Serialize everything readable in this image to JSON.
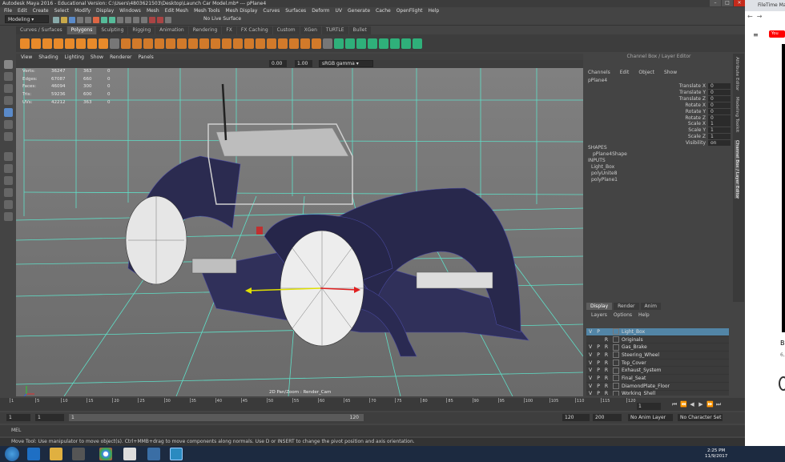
{
  "window": {
    "title": "Autodesk Maya 2016 - Educational Version: C:\\Users\\4803621503\\Desktop\\Launch Car Model.mb* --- pPlane4"
  },
  "menubar": [
    "File",
    "Edit",
    "Create",
    "Select",
    "Modify",
    "Display",
    "Windows",
    "Mesh",
    "Edit Mesh",
    "Mesh Tools",
    "Mesh Display",
    "Curves",
    "Surfaces",
    "Deform",
    "UV",
    "Generate",
    "Cache",
    "OpenFlight",
    "Help"
  ],
  "statusline": {
    "mode": "Modeling",
    "live_surface": "No Live Surface"
  },
  "shelf": {
    "tabs": [
      "Curves / Surfaces",
      "Polygons",
      "Sculpting",
      "Rigging",
      "Animation",
      "Rendering",
      "FX",
      "FX Caching",
      "Custom",
      "XGen",
      "TURTLE",
      "Bullet"
    ],
    "active": "Polygons"
  },
  "viewport": {
    "menus": [
      "View",
      "Shading",
      "Lighting",
      "Show",
      "Renderer",
      "Panels"
    ],
    "near": "0.00",
    "far": "1.00",
    "colorspace": "sRGB gamma",
    "hud": [
      {
        "label": "Verts:",
        "v1": "36247",
        "v2": "363",
        "v3": "0"
      },
      {
        "label": "Edges:",
        "v1": "67087",
        "v2": "660",
        "v3": "0"
      },
      {
        "label": "Faces:",
        "v1": "46094",
        "v2": "300",
        "v3": "0"
      },
      {
        "label": "Tris:",
        "v1": "59236",
        "v2": "600",
        "v3": "0"
      },
      {
        "label": "UVs:",
        "v1": "42212",
        "v2": "363",
        "v3": "0"
      }
    ],
    "camera_label": "2D Pan/Zoom : Render_Cam"
  },
  "channel_box": {
    "header": "Channel Box / Layer Editor",
    "menus": [
      "Channels",
      "Edit",
      "Object",
      "Show"
    ],
    "node": "pPlane4",
    "attributes": [
      {
        "name": "Translate X",
        "value": "0"
      },
      {
        "name": "Translate Y",
        "value": "0"
      },
      {
        "name": "Translate Z",
        "value": "0"
      },
      {
        "name": "Rotate X",
        "value": "0"
      },
      {
        "name": "Rotate Y",
        "value": "0"
      },
      {
        "name": "Rotate Z",
        "value": "0"
      },
      {
        "name": "Scale X",
        "value": "1"
      },
      {
        "name": "Scale Y",
        "value": "1"
      },
      {
        "name": "Scale Z",
        "value": "1"
      },
      {
        "name": "Visibility",
        "value": "on"
      }
    ],
    "shapes_header": "SHAPES",
    "shape": "pPlane4Shape",
    "inputs_header": "INPUTS",
    "inputs": [
      "Light_Box",
      "polyUnite8",
      "polyPlane1"
    ]
  },
  "side_tabs": [
    "Attribute Editor",
    "Modeling Toolkit",
    "Channel Box / Layer Editor"
  ],
  "layers": {
    "tabs": [
      "Display",
      "Render",
      "Anim"
    ],
    "active": "Display",
    "menus": [
      "Layers",
      "Options",
      "Help"
    ],
    "rows": [
      {
        "v": "V",
        "p": "P",
        "r": "",
        "name": "Light_Box",
        "selected": true
      },
      {
        "v": "",
        "p": "",
        "r": "R",
        "name": "Originals",
        "selected": false
      },
      {
        "v": "V",
        "p": "P",
        "r": "R",
        "name": "Gas_Brake",
        "selected": false
      },
      {
        "v": "V",
        "p": "P",
        "r": "R",
        "name": "Steering_Wheel",
        "selected": false
      },
      {
        "v": "V",
        "p": "P",
        "r": "R",
        "name": "Top_Cover",
        "selected": false
      },
      {
        "v": "V",
        "p": "P",
        "r": "R",
        "name": "Exhaust_System",
        "selected": false
      },
      {
        "v": "V",
        "p": "P",
        "r": "R",
        "name": "Final_Seat",
        "selected": false
      },
      {
        "v": "V",
        "p": "P",
        "r": "R",
        "name": "DiamondPlate_Floor",
        "selected": false
      },
      {
        "v": "V",
        "p": "P",
        "r": "R",
        "name": "Working_Shell",
        "selected": false
      }
    ]
  },
  "timeline": {
    "ticks": [
      "1",
      "5",
      "10",
      "15",
      "20",
      "25",
      "30",
      "35",
      "40",
      "45",
      "50",
      "55",
      "60",
      "65",
      "70",
      "75",
      "80",
      "85",
      "90",
      "95",
      "100",
      "105",
      "110",
      "115",
      "120"
    ],
    "current": "1"
  },
  "range": {
    "start": "1",
    "start2": "1",
    "slider_start": "1",
    "slider_end": "120",
    "end": "120",
    "end2": "200",
    "anim_layer": "No Anim Layer",
    "character_set": "No Character Set"
  },
  "cmdline": {
    "label": "MEL"
  },
  "helpline": "Move Tool: Use manipulator to move object(s). Ctrl+MMB+drag to move components along normals. Use D or INSERT to change the pivot position and axis orientation.",
  "taskbar": {
    "time": "2:25 PM",
    "date": "11/9/2017"
  },
  "browser": {
    "tab_title": "FileTime Mac",
    "logo_text": "You",
    "heading_char": "B",
    "sub_char": "6,"
  }
}
